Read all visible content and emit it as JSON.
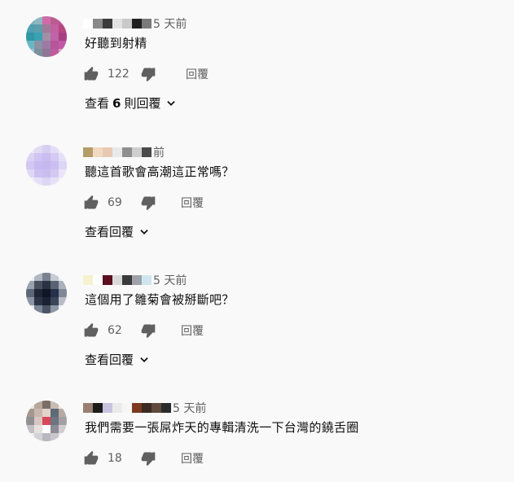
{
  "reply_label": "回覆",
  "comments": [
    {
      "time": "5 天前",
      "text": "好聽到射精",
      "likes": "122",
      "view_replies_prefix": "查看",
      "view_replies_count": "6",
      "view_replies_suffix": "則回覆",
      "avatar_colors": [
        "#7fb0c0",
        "#8fb7c2",
        "#d06aa8",
        "#b95c8f",
        "#c24d9c",
        "#4fa0b0",
        "#5d9eaa",
        "#9f7b9a",
        "#c45fa0",
        "#b4487f",
        "#2f97a6",
        "#3aa1b3",
        "#a28fa5",
        "#c063a8",
        "#a83f84",
        "#6ab7c4",
        "#8a92a3",
        "#9d7aa4",
        "#b6559b",
        "#c05aa6",
        "#98c5cf",
        "#7c8f9e",
        "#8f7595",
        "#c25aa0",
        "#d6a4c2"
      ],
      "name_pixels": [
        "#ffffff",
        "#8a8a8a",
        "#3b3b3b",
        "#e2e2e2",
        "#c9c9c9",
        "#1f1f1f",
        "#7a7a7a"
      ]
    },
    {
      "time": "前",
      "text": "聽這首歌會高潮這正常嗎？",
      "likes": "69",
      "view_replies_label": "查看回覆",
      "avatar_colors": [
        "#eee9f6",
        "#e2dcf3",
        "#d7cff3",
        "#e4ddf6",
        "#f1eef9",
        "#dcd3f4",
        "#cfc4f3",
        "#c9bdf1",
        "#d4caf3",
        "#e6e0f6",
        "#d1c7f2",
        "#c6baf0",
        "#c4b8f0",
        "#cbbff1",
        "#ddd5f4",
        "#dfd8f5",
        "#cdc2f1",
        "#c9bdf0",
        "#d3c9f2",
        "#e9e4f7",
        "#f2eff9",
        "#e6e0f6",
        "#ddd6f4",
        "#e7e1f6",
        "#f4f2fa"
      ],
      "name_pixels": [
        "#b39e6a",
        "#f1d9c2",
        "#e7c9b3",
        "#e9e9e9",
        "#8f8f8f",
        "#cfcfcf",
        "#4a4a4a"
      ]
    },
    {
      "time": "5 天前",
      "text": "這個用了雛菊會被掰斷吧？",
      "likes": "62",
      "view_replies_label": "查看回覆",
      "avatar_colors": [
        "#e9ecf0",
        "#b2b8c2",
        "#7a8290",
        "#c6ccd4",
        "#eef0f3",
        "#9aa3b0",
        "#46505f",
        "#2b3342",
        "#5a6373",
        "#aab1bb",
        "#5d6676",
        "#1f2737",
        "#0f1726",
        "#25304a",
        "#7f8897",
        "#8b94a2",
        "#2c3547",
        "#1a2233",
        "#3a4558",
        "#b7bdc6",
        "#e2e5ea",
        "#7c8594",
        "#4b5566",
        "#8e97a5",
        "#edf0f3"
      ],
      "name_pixels": [
        "#f3f3cf",
        "#ffffff",
        "#5a1020",
        "#d9d9d9",
        "#3a3a3a",
        "#9fa3a8",
        "#cfe6ef"
      ]
    },
    {
      "time": "5 天前",
      "text": "我們需要一張屌炸天的專輯清洗一下台灣的鐃舌圈",
      "likes": "18",
      "avatar_colors": [
        "#e7e2dd",
        "#b7a79a",
        "#7b6e66",
        "#c7bcb4",
        "#efebe7",
        "#a5978e",
        "#c9b6ad",
        "#e2d3cc",
        "#5e6b77",
        "#b6aaa3",
        "#8f8f94",
        "#d8c7c0",
        "#d9465a",
        "#6d7580",
        "#a4a0a6",
        "#c3bfc4",
        "#e8e0dd",
        "#ffffff",
        "#8d8c96",
        "#d0ccd0",
        "#eeeeee",
        "#d3d3d7",
        "#b9b7bf",
        "#c9c7cd",
        "#f0efef"
      ],
      "name_pixels": [
        "#9a8070",
        "#1c1c1c",
        "#c7c2de",
        "#eaeaea",
        "#f6f6f6",
        "#7c3a20",
        "#3b2a24",
        "#5f4a3c",
        "#2b2b2b"
      ]
    }
  ]
}
